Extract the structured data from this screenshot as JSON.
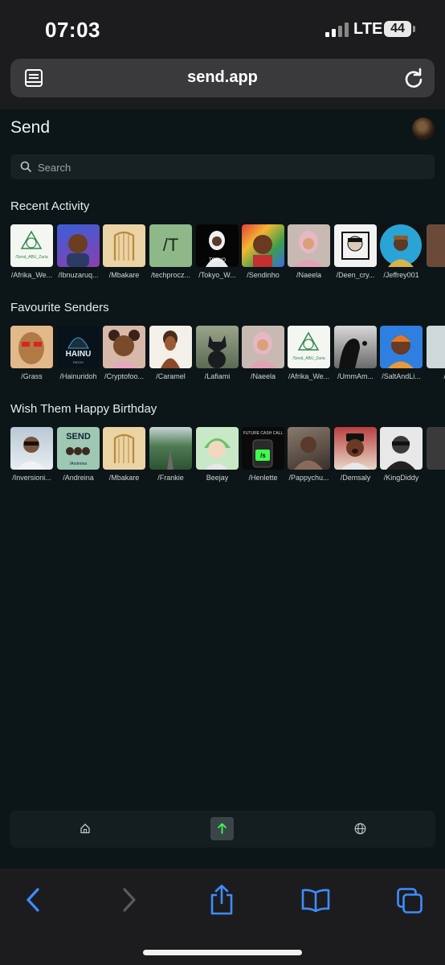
{
  "status_bar": {
    "time": "07:03",
    "network": "LTE",
    "battery": "44"
  },
  "browser": {
    "url": "send.app"
  },
  "page": {
    "title": "Send",
    "search_placeholder": "Search"
  },
  "sections": {
    "recent": {
      "title": "Recent Activity",
      "items": [
        "/Afrika_We...",
        "/Ibnuzaruq...",
        "/Mbakare",
        "/techprocz...",
        "/Tokyo_W...",
        "/Sendinho",
        "/Naeela",
        "/Deen_cry...",
        "/Jeffrey001",
        "/"
      ]
    },
    "favourites": {
      "title": "Favourite Senders",
      "items": [
        "/Grass",
        "/Hainuridoh",
        "/Cryptofoo...",
        "/Caramel",
        "/Lafiami",
        "/Naeela",
        "/Afrika_We...",
        "/UmmAm...",
        "/SaltAndLi...",
        "/m"
      ]
    },
    "birthday": {
      "title": "Wish Them Happy Birthday",
      "items": [
        "/Inversioni...",
        "/Andreina",
        "/Mbakare",
        "/Frankie",
        "Beejay",
        "/Henlette",
        "/Pappychu...",
        "/Demsaly",
        "/KingDiddy",
        "/"
      ]
    }
  },
  "thumb_text": {
    "send_abu_zaria": "/Send_ABU_Zaria",
    "slash_t": "/T",
    "tokyo": "TOKYO",
    "hainu": "HAINU",
    "hainu_sub": "RIDOH",
    "send": "SEND",
    "andreina_sub": "/Andreina",
    "future_cash": "FUTURE CASH CALL",
    "slash_s": "/s"
  },
  "colors": {
    "background": "#0c1517",
    "accent_green": "#40fb50",
    "ios_blue": "#3f8cff"
  },
  "icons": [
    "tabs-icon",
    "reload-icon",
    "search-icon",
    "home-icon",
    "send-arrow-icon",
    "globe-icon",
    "back-icon",
    "forward-icon",
    "share-icon",
    "bookmarks-icon",
    "tabs-overview-icon"
  ]
}
